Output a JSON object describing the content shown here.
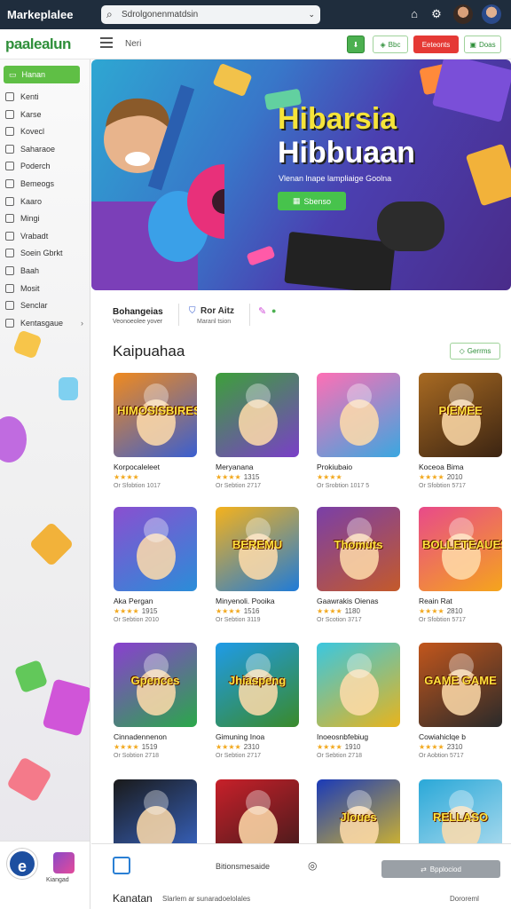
{
  "topbar": {
    "app_title": "Markeplalee",
    "search_text": "Sdrolgonenmatdsin",
    "icons": [
      "home-icon",
      "settings-icon"
    ]
  },
  "navbar": {
    "brand": "paalealun",
    "menu_label": "Neri",
    "btn_a": "",
    "btn_b": "Bbc",
    "btn_c": "Eeteonts",
    "btn_d": "Doas"
  },
  "sidebar": {
    "active": "Hanan",
    "items": [
      {
        "label": "Kenti",
        "chev": false
      },
      {
        "label": "Karse",
        "chev": false
      },
      {
        "label": "Kovecl",
        "chev": false
      },
      {
        "label": "Saharaoe",
        "chev": false
      },
      {
        "label": "Poderch",
        "chev": false
      },
      {
        "label": "Bemeogs",
        "chev": false
      },
      {
        "label": "Kaaro",
        "chev": false
      },
      {
        "label": "Mingi",
        "chev": false
      },
      {
        "label": "Vrabadt",
        "chev": false
      },
      {
        "label": "Soein Gbrkt",
        "chev": false
      },
      {
        "label": "Baah",
        "chev": false
      },
      {
        "label": "Mosit",
        "chev": false
      },
      {
        "label": "Senclar",
        "chev": false
      },
      {
        "label": "Kentasgaue",
        "chev": true
      }
    ],
    "bottom_app_label": "Kiangad"
  },
  "hero": {
    "title_line1": "Hibarsia",
    "title_line2": "Hibbuaan",
    "subtitle": "Vlenan lnape lampliaige Goolna",
    "button": "Sbenso"
  },
  "strip": {
    "a_title": "Bohangeias",
    "a_sub": "Veonoeolee yover",
    "b_title": "Ror Aitz",
    "b_sub": "Maranl tsion"
  },
  "section": {
    "title": "Kaipuahaa",
    "button": "Gerrms"
  },
  "games": [
    {
      "title": "Korpocaleleet",
      "rating": "★★★★",
      "score": "",
      "meta": "Or Sfobtion 1017",
      "thumb_text": "HIMOSISBIRES",
      "c1": "#f08a1e",
      "c2": "#3a5fd0"
    },
    {
      "title": "Meryanana",
      "rating": "★★★★",
      "score": "1315",
      "meta": "Or Sebtion 2717",
      "thumb_text": "",
      "c1": "#3da03a",
      "c2": "#7a3fc8"
    },
    {
      "title": "Prokiubaio",
      "rating": "★★★★",
      "score": "",
      "meta": "Or Srobtion 1017 5",
      "thumb_text": "",
      "c1": "#ff6fb5",
      "c2": "#3aa7e0"
    },
    {
      "title": "Koceoa Bima",
      "rating": "★★★★",
      "score": "2010",
      "meta": "Or Sfobtion 5717",
      "thumb_text": "PIEMEE",
      "c1": "#a86a22",
      "c2": "#3b2412"
    },
    {
      "title": "Aka Pergan",
      "rating": "★★★★",
      "score": "1915",
      "meta": "Or Sebtion 2010",
      "thumb_text": "",
      "c1": "#8a4fd0",
      "c2": "#2a8dd8"
    },
    {
      "title": "Minyenoli. Pooika",
      "rating": "★★★★",
      "score": "1516",
      "meta": "Or Sebtion 3119",
      "thumb_text": "BEREMU",
      "c1": "#f5b21c",
      "c2": "#1f7bd8"
    },
    {
      "title": "Gaawrakis Oienas",
      "rating": "★★★★",
      "score": "1180",
      "meta": "Or Scotion 3717",
      "thumb_text": "Thomuts",
      "c1": "#7a3fa8",
      "c2": "#c45a2a"
    },
    {
      "title": "Reain Rat",
      "rating": "★★★★",
      "score": "2810",
      "meta": "Or Sfobtion 5717",
      "thumb_text": "BOLLETEAUES",
      "c1": "#e84a8a",
      "c2": "#f5a51c"
    },
    {
      "title": "Cinnadennenon",
      "rating": "★★★★",
      "score": "1519",
      "meta": "Or Sobtion 2718",
      "thumb_text": "Gpences",
      "c1": "#8a3fd0",
      "c2": "#2aa84a"
    },
    {
      "title": "Gimuning Inoa",
      "rating": "★★★★",
      "score": "2310",
      "meta": "Or Sebtion 2717",
      "thumb_text": "Jhiaspeng",
      "c1": "#1f9be8",
      "c2": "#3a8a2a"
    },
    {
      "title": "Inoeosnbfebiug",
      "rating": "★★★★",
      "score": "1910",
      "meta": "Or Sebtion 2718",
      "thumb_text": "",
      "c1": "#3ac7e0",
      "c2": "#e8b41c"
    },
    {
      "title": "Cowiahiclqe b",
      "rating": "★★★★",
      "score": "2310",
      "meta": "Or Aobtion 5717",
      "thumb_text": "GAME GAME",
      "c1": "#c2561c",
      "c2": "#2a2a2a"
    },
    {
      "title": "",
      "rating": "",
      "score": "",
      "meta": "",
      "thumb_text": "",
      "c1": "#1a1a1a",
      "c2": "#3a6ad0"
    },
    {
      "title": "",
      "rating": "",
      "score": "",
      "meta": "",
      "thumb_text": "",
      "c1": "#c8202a",
      "c2": "#3a1a1a"
    },
    {
      "title": "",
      "rating": "",
      "score": "",
      "meta": "",
      "thumb_text": "Jloues",
      "c1": "#1a3ab8",
      "c2": "#e8c41c"
    },
    {
      "title": "",
      "rating": "",
      "score": "",
      "meta": "",
      "thumb_text": "RELLASO",
      "c1": "#2aa8d8",
      "c2": "#b8e0f0"
    }
  ],
  "footer": {
    "label": "Bitionsmesaide",
    "button": "Bpplociod",
    "bottom_left": "Kanatan",
    "bottom_mid": "Slarlem ar sunaradoelolales",
    "bottom_right": "Dororeml"
  },
  "colors": {
    "topbar": "#1f2d3d",
    "brand_green": "#2f8f3a",
    "accent_green": "#5fbf45",
    "hero_title_yellow": "#f5e43a",
    "star": "#f2a81d"
  }
}
